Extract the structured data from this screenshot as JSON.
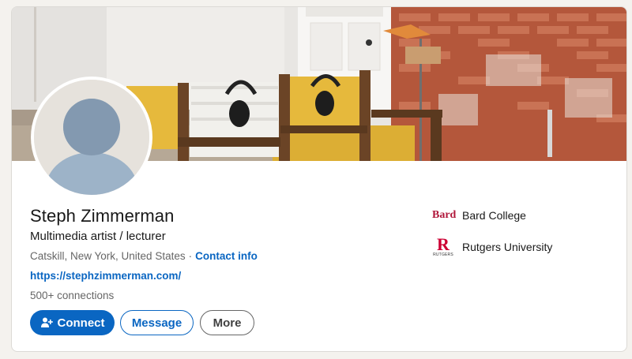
{
  "profile": {
    "name": "Steph Zimmerman",
    "headline": "Multimedia artist / lecturer",
    "location": "Catskill, New York, United States",
    "separator": "·",
    "contact_info": "Contact info",
    "website": "https://stephzimmerman.com/",
    "connections": "500+ connections"
  },
  "actions": {
    "connect": "Connect",
    "message": "Message",
    "more": "More"
  },
  "education": [
    {
      "logo_text": "Bard",
      "name": "Bard College"
    },
    {
      "logo_text": "R",
      "logo_sub": "RUTGERS",
      "name": "Rutgers University"
    }
  ],
  "colors": {
    "brand_blue": "#0a66c2",
    "bard_red": "#b0173a",
    "rutgers_red": "#cc0033"
  },
  "icons": {
    "connect": "add-person-icon"
  }
}
